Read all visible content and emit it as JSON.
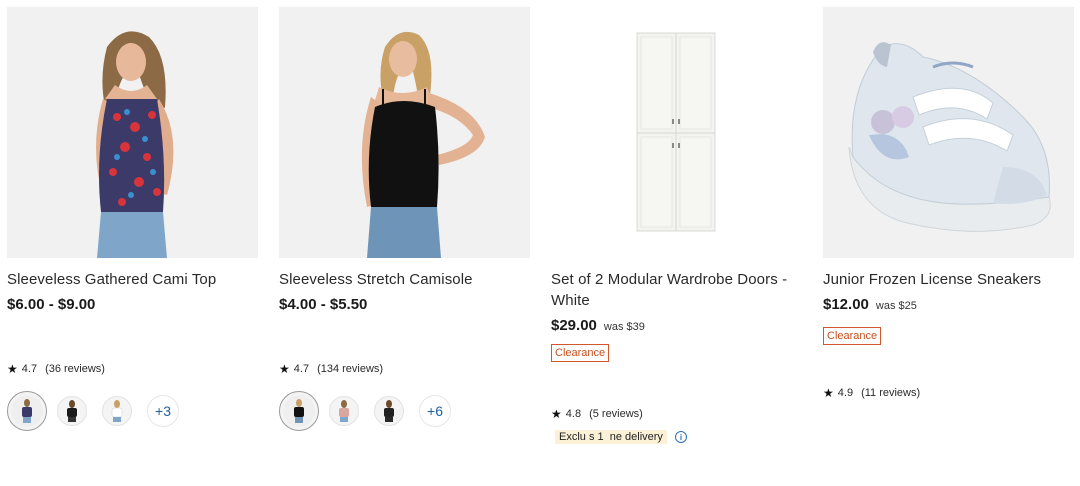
{
  "products": [
    {
      "title": "Sleeveless Gathered Cami Top",
      "price": "$6.00 - $9.00",
      "rating": "4.7",
      "reviews": "(36 reviews)",
      "more_colors": "+3"
    },
    {
      "title": "Sleeveless Stretch Camisole",
      "price": "$4.00 - $5.50",
      "rating": "4.7",
      "reviews": "(134 reviews)",
      "more_colors": "+6"
    },
    {
      "title": "Set of 2 Modular Wardrobe Doors - White",
      "price": "$29.00",
      "was": "was $39",
      "badge": "Clearance",
      "rating": "4.8",
      "reviews": "(5 reviews)",
      "delivery": "Exclu s 1  ne delivery"
    },
    {
      "title": "Junior Frozen License Sneakers",
      "price": "$12.00",
      "was": "was $25",
      "badge": "Clearance",
      "rating": "4.9",
      "reviews": "(11 reviews)"
    }
  ],
  "icons": {
    "rating": "star-icon",
    "info": "info-icon"
  },
  "colors": {
    "clearance": "#d2572a",
    "link": "#1f5f9e",
    "delivery_bg": "#fbf1d6"
  }
}
